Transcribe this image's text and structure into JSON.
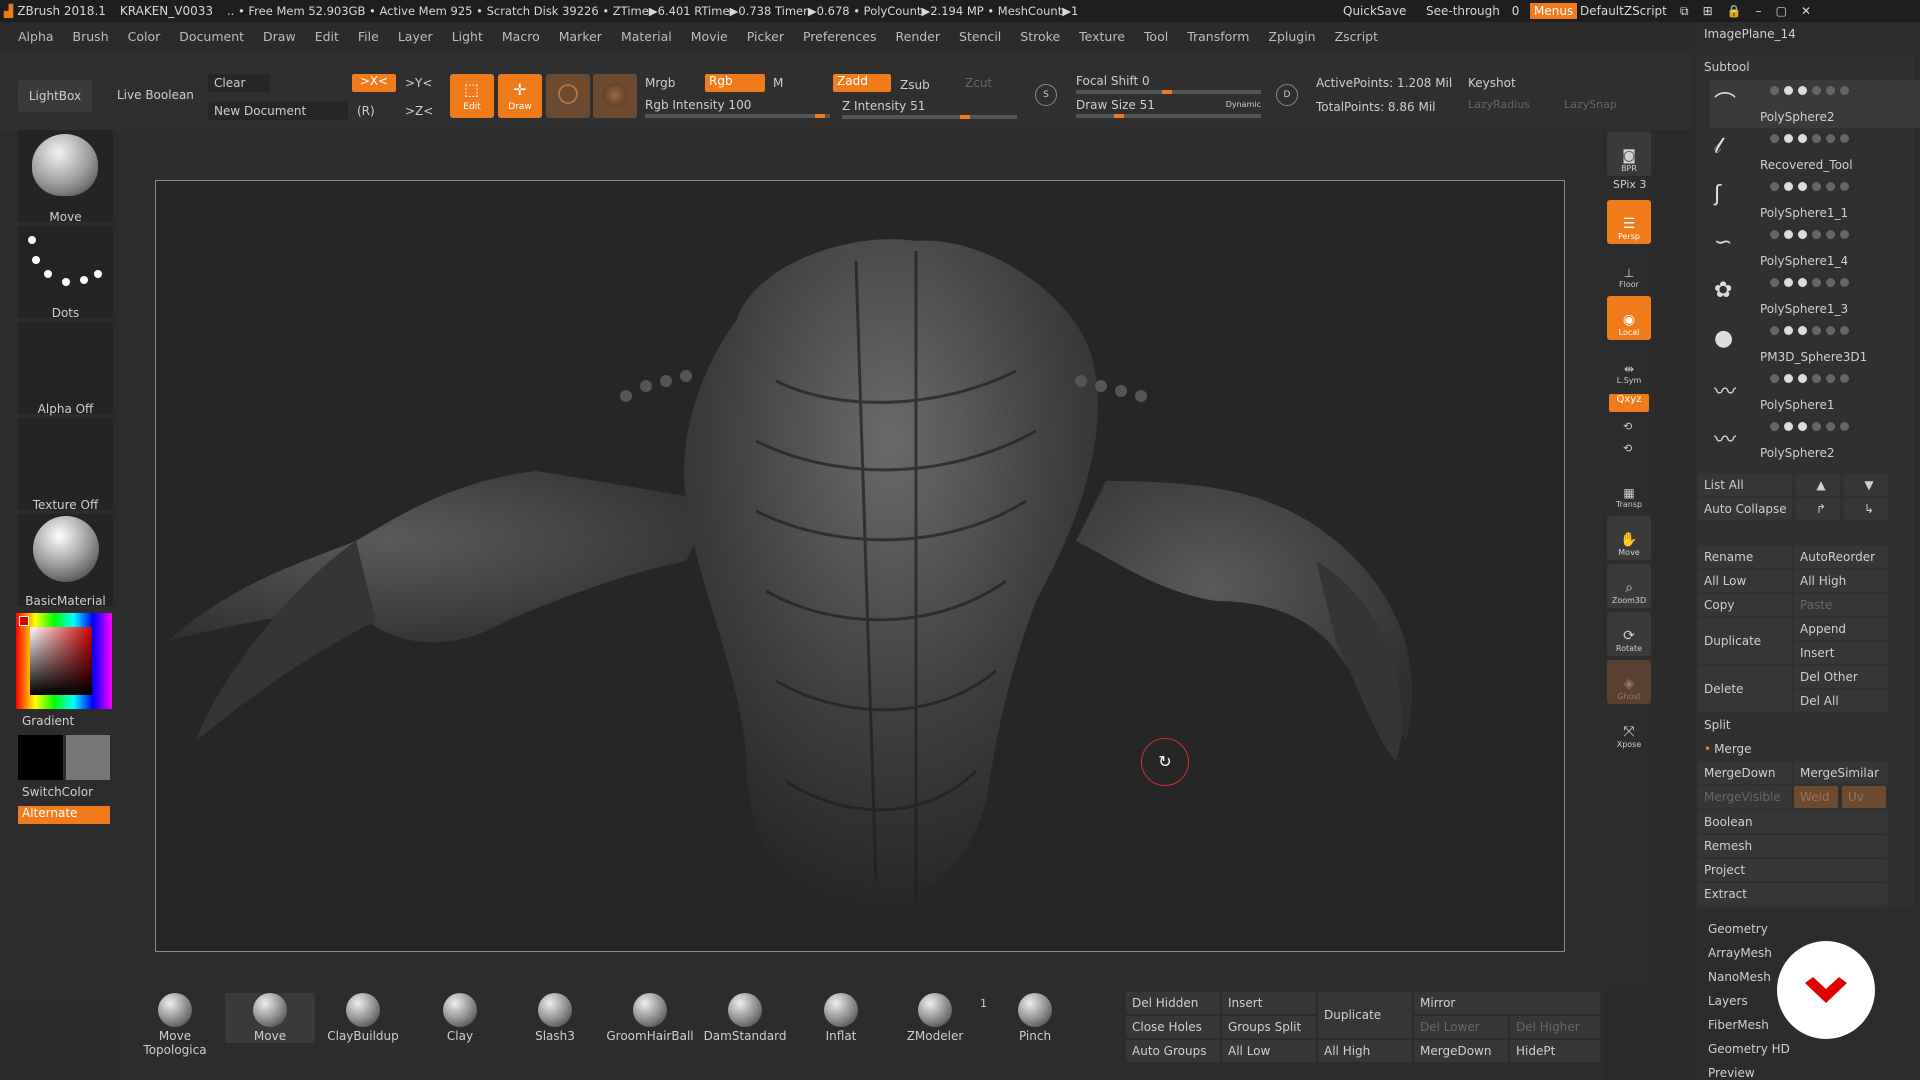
{
  "titlebar": {
    "app": "ZBrush 2018.1",
    "project": "KRAKEN_V0033",
    "stats": ".. • Free Mem 52.903GB • Active Mem 925 • Scratch Disk 39226 • ZTime▶6.401 RTime▶0.738 Timer▶0.678 • PolyCount▶2.194 MP • MeshCount▶1",
    "quicksave": "QuickSave",
    "seethrough": "See-through",
    "seethrough_value": "0",
    "menus": "Menus",
    "zscript": "DefaultZScript"
  },
  "menubar": [
    "Alpha",
    "Brush",
    "Color",
    "Document",
    "Draw",
    "Edit",
    "File",
    "Layer",
    "Light",
    "Macro",
    "Marker",
    "Material",
    "Movie",
    "Picker",
    "Preferences",
    "Render",
    "Stencil",
    "Stroke",
    "Texture",
    "Tool",
    "Transform",
    "Zplugin",
    "Zscript"
  ],
  "shelf": {
    "lightbox": "LightBox",
    "live_boolean": "Live Boolean",
    "clear": "Clear",
    "new_document": "New Document",
    "x_sym": ">X<",
    "y_sym": ">Y<",
    "z_sym": ">Z<",
    "r": "(R)",
    "edit": "Edit",
    "draw": "Draw",
    "mrgb": "Mrgb",
    "rgb": "Rgb",
    "m": "M",
    "rgb_intensity": "Rgb Intensity 100",
    "zadd": "Zadd",
    "zsub": "Zsub",
    "zcut": "Zcut",
    "z_intensity": "Z Intensity 51",
    "focal_shift": "Focal Shift 0",
    "draw_size": "Draw Size 51",
    "dynamic": "Dynamic",
    "active_points": "ActivePoints: 1.208 Mil",
    "total_points": "TotalPoints: 8.86 Mil",
    "keyshot": "Keyshot",
    "lazyradius": "LazyRadius",
    "lazysnap": "LazySnap"
  },
  "lefttray": {
    "move": "Move",
    "dots": "Dots",
    "alpha_off": "Alpha Off",
    "texture_off": "Texture Off",
    "material": "BasicMaterial",
    "gradient": "Gradient",
    "switchcolor": "SwitchColor",
    "alternate": "Alternate"
  },
  "rightshelf": {
    "bpr": "BPR",
    "spix": "SPix 3",
    "persp": "Persp",
    "floor": "Floor",
    "local": "Local",
    "lsym": "L.Sym",
    "xyz": "Qxyz",
    "transp": "Transp",
    "move": "Move",
    "zoom3d": "Zoom3D",
    "rotate": "Rotate",
    "ghost": "Ghost",
    "xpose": "Xpose"
  },
  "rightpanel": {
    "imageplane": "ImagePlane_14",
    "subtool_title": "Subtool",
    "subtools": [
      "PolySphere2",
      "Recovered_Tool",
      "PolySphere1_1",
      "PolySphere1_4",
      "PolySphere1_3",
      "PM3D_Sphere3D1",
      "PolySphere1",
      "PolySphere2"
    ],
    "list_all": "List All",
    "auto_collapse": "Auto Collapse",
    "rename": "Rename",
    "autoreorder": "AutoReorder",
    "all_low": "All Low",
    "all_high": "All High",
    "copy": "Copy",
    "paste": "Paste",
    "duplicate": "Duplicate",
    "append": "Append",
    "insert": "Insert",
    "delete": "Delete",
    "del_other": "Del Other",
    "del_all": "Del All",
    "split": "Split",
    "merge": "Merge",
    "mergedown": "MergeDown",
    "mergesimilar": "MergeSimilar",
    "mergevisible": "MergeVisible",
    "weld": "Weld",
    "uv": "Uv",
    "boolean": "Boolean",
    "remesh": "Remesh",
    "project": "Project",
    "extract": "Extract",
    "geometry": "Geometry",
    "arraymesh": "ArrayMesh",
    "nanomesh": "NanoMesh",
    "layers": "Layers",
    "fibermesh": "FiberMesh",
    "geometry_hd": "Geometry HD",
    "preview": "Preview"
  },
  "bottomshelf": {
    "brushes": [
      "Move Topologica",
      "Move",
      "ClayBuildup",
      "Clay",
      "Slash3",
      "GroomHairBall",
      "DamStandard",
      "Inflat",
      "ZModeler",
      "Pinch"
    ],
    "zmodeler_count": "1",
    "del_hidden": "Del Hidden",
    "insert": "Insert",
    "duplicate": "Duplicate",
    "mirror": "Mirror",
    "close_holes": "Close Holes",
    "groups_split": "Groups Split",
    "del_lower": "Del Lower",
    "del_higher": "Del Higher",
    "auto_groups": "Auto Groups",
    "all_low": "All Low",
    "all_high": "All High",
    "mergedown": "MergeDown",
    "hidept": "HidePt"
  },
  "colors": {
    "accent": "#f07b1a",
    "bg": "#2a2a2a",
    "logo": "#e00000"
  }
}
